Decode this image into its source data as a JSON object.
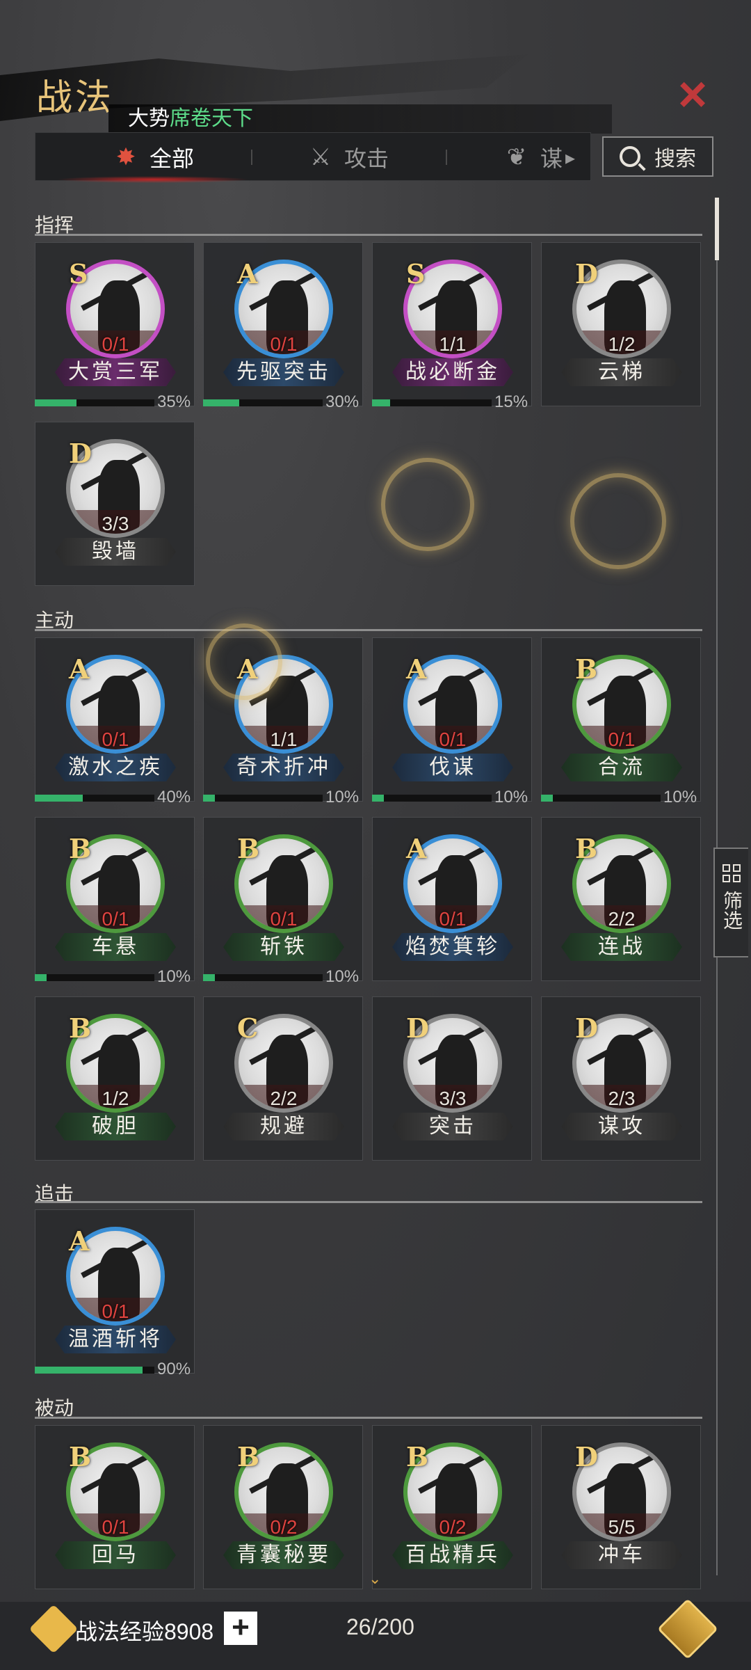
{
  "header": {
    "title": "战法",
    "close_label": "×",
    "season_prefix": "大势",
    "season_highlight": "席卷天下"
  },
  "tabs": [
    {
      "label": "全部",
      "icon": "scroll-bundle-icon",
      "active": true
    },
    {
      "label": "攻击",
      "icon": "crossed-swords-icon",
      "active": false
    },
    {
      "label": "谋",
      "icon": "feather-icon",
      "active": false
    }
  ],
  "tabs_more": "▸",
  "search": {
    "label": "搜索"
  },
  "filter": {
    "label": "筛选"
  },
  "sections": {
    "command": "指挥",
    "active": "主动",
    "pursuit": "追击",
    "passive": "被动"
  },
  "cards": [
    {
      "grade": "S",
      "count": "0/1",
      "red": true,
      "name": "大赏三军",
      "pct": "35%",
      "progress": 0.35
    },
    {
      "grade": "A",
      "count": "0/1",
      "red": true,
      "name": "先驱突击",
      "pct": "30%",
      "progress": 0.3
    },
    {
      "grade": "S",
      "count": "1/1",
      "red": false,
      "name": "战必断金",
      "pct": "15%",
      "progress": 0.15
    },
    {
      "grade": "D",
      "count": "1/2",
      "red": false,
      "name": "云梯",
      "pct": "",
      "progress": null
    },
    {
      "grade": "D",
      "count": "3/3",
      "red": false,
      "name": "毁墙",
      "pct": "",
      "progress": null
    },
    {
      "grade": "A",
      "count": "0/1",
      "red": true,
      "name": "激水之疾",
      "pct": "40%",
      "progress": 0.4
    },
    {
      "grade": "A",
      "count": "1/1",
      "red": false,
      "name": "奇术折冲",
      "pct": "10%",
      "progress": 0.1
    },
    {
      "grade": "A",
      "count": "0/1",
      "red": true,
      "name": "伐谋",
      "pct": "10%",
      "progress": 0.1
    },
    {
      "grade": "B",
      "count": "0/1",
      "red": true,
      "name": "合流",
      "pct": "10%",
      "progress": 0.1
    },
    {
      "grade": "B",
      "count": "0/1",
      "red": true,
      "name": "车悬",
      "pct": "10%",
      "progress": 0.1
    },
    {
      "grade": "B",
      "count": "0/1",
      "red": true,
      "name": "斩铁",
      "pct": "10%",
      "progress": 0.1
    },
    {
      "grade": "A",
      "count": "0/1",
      "red": true,
      "name": "焰焚箕轸",
      "pct": "",
      "progress": null
    },
    {
      "grade": "B",
      "count": "2/2",
      "red": false,
      "name": "连战",
      "pct": "",
      "progress": null
    },
    {
      "grade": "B",
      "count": "1/2",
      "red": false,
      "name": "破胆",
      "pct": "",
      "progress": null
    },
    {
      "grade": "C",
      "count": "2/2",
      "red": false,
      "name": "规避",
      "pct": "",
      "progress": null
    },
    {
      "grade": "D",
      "count": "3/3",
      "red": false,
      "name": "突击",
      "pct": "",
      "progress": null
    },
    {
      "grade": "D",
      "count": "2/3",
      "red": false,
      "name": "谋攻",
      "pct": "",
      "progress": null
    },
    {
      "grade": "A",
      "count": "0/1",
      "red": true,
      "name": "温酒斩将",
      "pct": "90%",
      "progress": 0.9
    },
    {
      "grade": "B",
      "count": "0/1",
      "red": true,
      "name": "回马",
      "pct": "",
      "progress": null
    },
    {
      "grade": "B",
      "count": "0/2",
      "red": true,
      "name": "青囊秘要",
      "pct": "",
      "progress": null
    },
    {
      "grade": "B",
      "count": "0/2",
      "red": true,
      "name": "百战精兵",
      "pct": "",
      "progress": null
    },
    {
      "grade": "D",
      "count": "5/5",
      "red": false,
      "name": "冲车",
      "pct": "",
      "progress": null
    }
  ],
  "footer": {
    "exp_label": "战法经验8908",
    "plus_label": "+",
    "capacity": "26/200",
    "scroll_hint": "⌄"
  }
}
